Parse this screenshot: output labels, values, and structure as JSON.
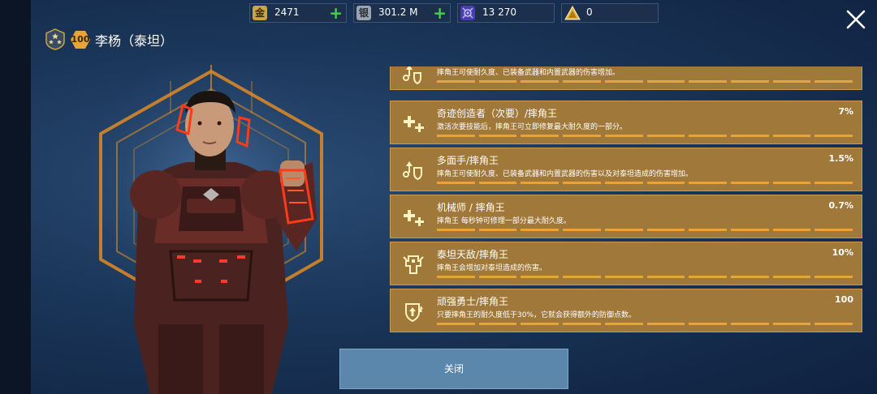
{
  "resources": [
    {
      "icon": "gold-coin-icon",
      "glyph": "金",
      "value": "2471",
      "has_add": true,
      "color": "#c9a548"
    },
    {
      "icon": "silver-coin-icon",
      "glyph": "银",
      "value": "301.2 M",
      "has_add": true,
      "color": "#9aa4b0"
    },
    {
      "icon": "key-hex-icon",
      "glyph": "",
      "value": "13 270",
      "has_add": false,
      "color": "#6b5bd6"
    },
    {
      "icon": "triangle-token-icon",
      "glyph": "",
      "value": "0",
      "has_add": false,
      "color": "#e8b43a"
    }
  ],
  "pilot": {
    "level": "100",
    "name": "李杨（泰坦）"
  },
  "skills": [
    {
      "icon": "damage-boost-icon",
      "title": "",
      "value": "",
      "desc": "摔角王可使耐久度、已装备武器和内置武器的伤害增加。"
    },
    {
      "icon": "repair-plus-icon",
      "title": "奇迹创造者（次要）/摔角王",
      "value": "7%",
      "desc": "激活次要技能后，摔角王可立即修复最大耐久度的一部分。"
    },
    {
      "icon": "damage-boost-icon",
      "title": "多面手/摔角王",
      "value": "1.5%",
      "desc": "摔角王可使耐久度、已装备武器和内置武器的伤害以及对泰坦造成的伤害增加。"
    },
    {
      "icon": "repair-plus-icon",
      "title": "机械师 / 摔角王",
      "value": "0.7%",
      "desc": "摔角王 每秒钟可修理一部分最大耐久度。"
    },
    {
      "icon": "titan-slayer-icon",
      "title": "泰坦天敌/摔角王",
      "value": "10%",
      "desc": "摔角王会增加对泰坦造成的伤害。"
    },
    {
      "icon": "shield-up-icon",
      "title": "顽强勇士/摔角王",
      "value": "100",
      "desc": "只要摔角王的耐久度低于30%，它就会获得额外的防御点数。"
    }
  ],
  "close_button": "关闭",
  "colors": {
    "panel": "#a0783a",
    "bar": "#e8a33a",
    "accent": "#f08020"
  }
}
